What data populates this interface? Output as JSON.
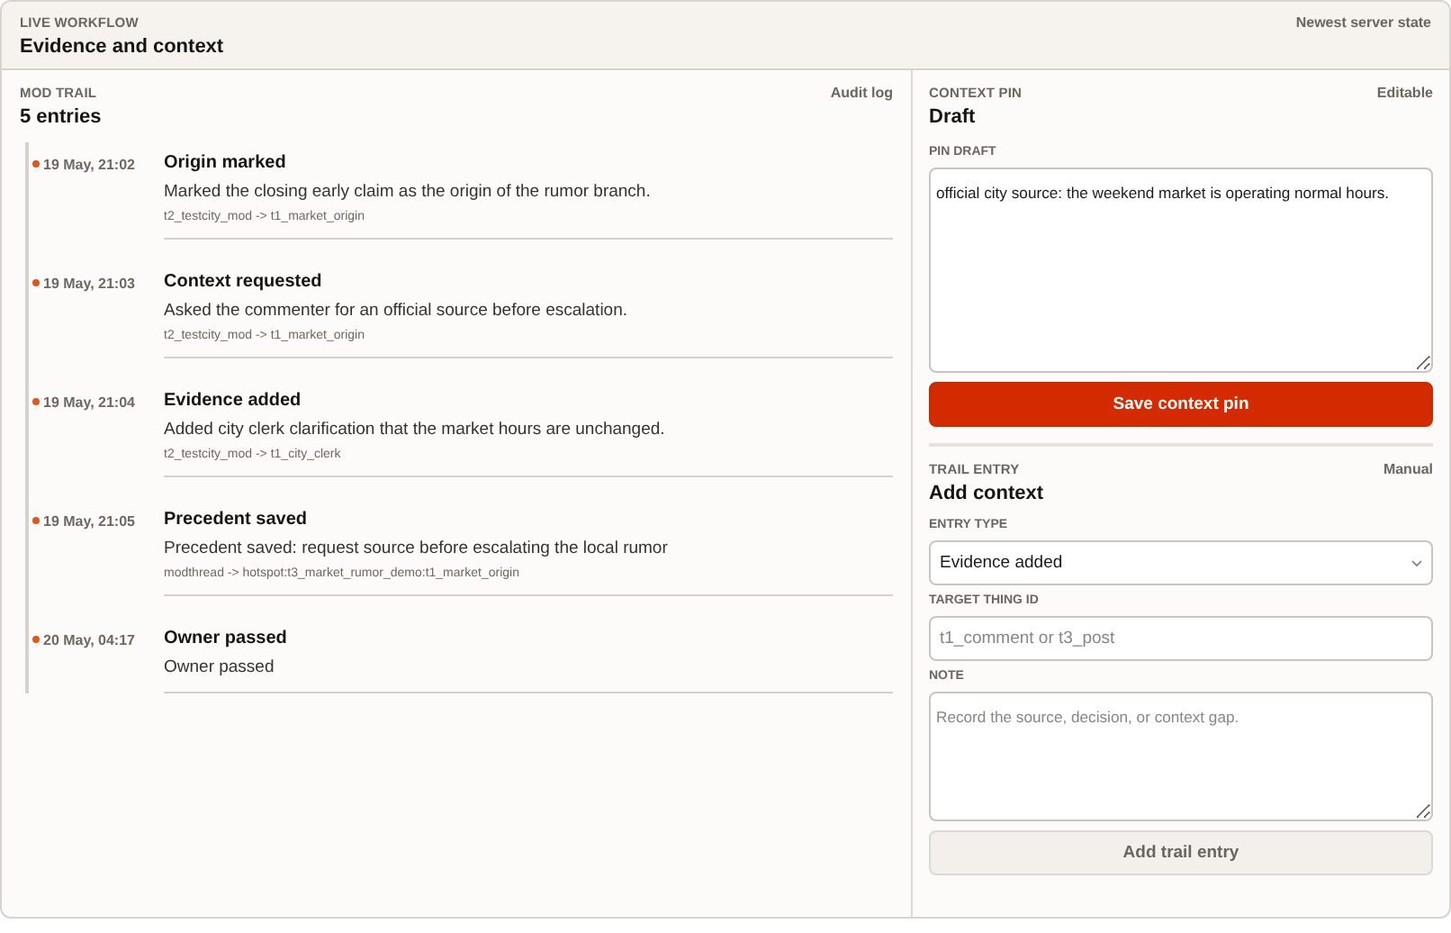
{
  "header": {
    "eyebrow": "LIVE WORKFLOW",
    "title": "Evidence and context",
    "status": "Newest server state"
  },
  "trail": {
    "eyebrow": "MOD TRAIL",
    "title": "5 entries",
    "aside": "Audit log",
    "entries": [
      {
        "time": "19 May, 21:02",
        "title": "Origin marked",
        "text": "Marked the closing early claim as the origin of the rumor branch.",
        "meta": "t2_testcity_mod -> t1_market_origin"
      },
      {
        "time": "19 May, 21:03",
        "title": "Context requested",
        "text": "Asked the commenter for an official source before escalation.",
        "meta": "t2_testcity_mod -> t1_market_origin"
      },
      {
        "time": "19 May, 21:04",
        "title": "Evidence added",
        "text": "Added city clerk clarification that the market hours are unchanged.",
        "meta": "t2_testcity_mod -> t1_city_clerk"
      },
      {
        "time": "19 May, 21:05",
        "title": "Precedent saved",
        "text": "Precedent saved: request source before escalating the local rumor",
        "meta": "modthread -> hotspot:t3_market_rumor_demo:t1_market_origin"
      },
      {
        "time": "20 May, 04:17",
        "title": "Owner passed",
        "text": "Owner passed"
      }
    ]
  },
  "pin": {
    "eyebrow": "CONTEXT PIN",
    "title": "Draft",
    "aside": "Editable",
    "field_label": "PIN DRAFT",
    "value": "official city source: the weekend market is operating normal hours.",
    "button": {
      "label": "Save context pin",
      "disabled": false
    }
  },
  "entry": {
    "eyebrow": "TRAIL ENTRY",
    "title": "Add context",
    "aside": "Manual",
    "type_label": "ENTRY TYPE",
    "type_value": "Evidence added",
    "target_label": "TARGET THING ID",
    "target_placeholder": "t1_comment or t3_post",
    "note_label": "NOTE",
    "note_placeholder": "Record the source, decision, or context gap.",
    "button": {
      "label": "Add trail entry",
      "disabled": true
    }
  }
}
